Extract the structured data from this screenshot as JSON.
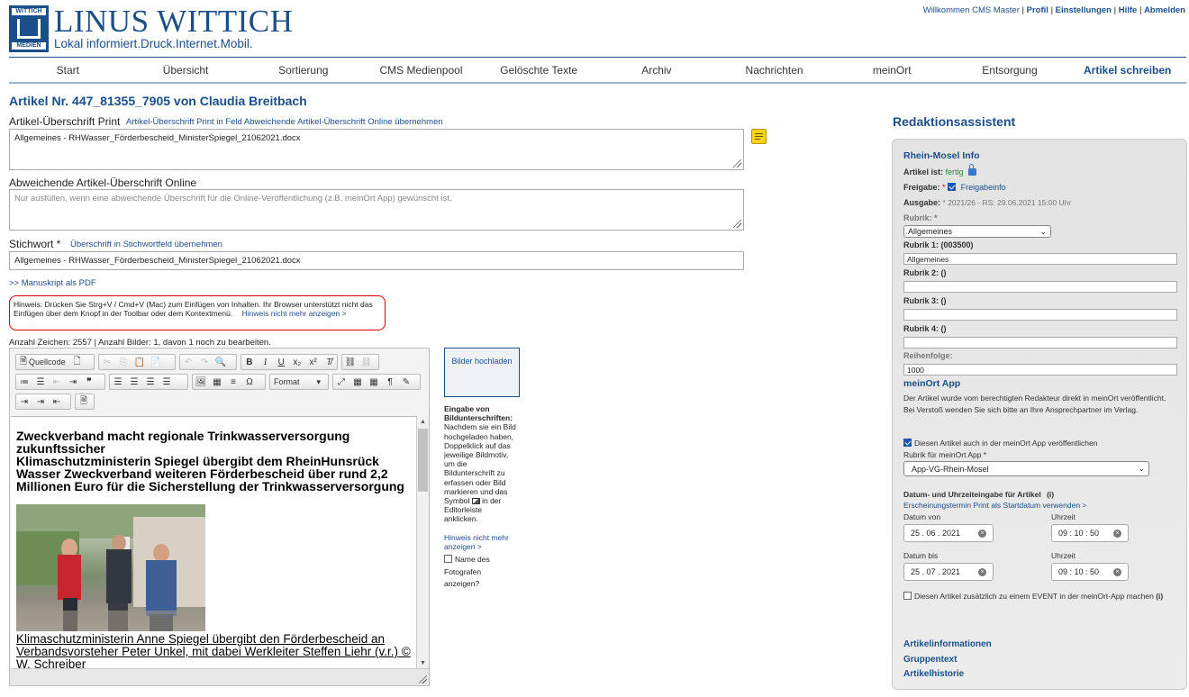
{
  "logo": {
    "box_top": "WITTICH",
    "box_bottom": "MEDIEN",
    "title": "LINUS WITTICH",
    "subtitle": "Lokal informiert.Druck.Internet.Mobil."
  },
  "toplinks": {
    "welcome": "Willkommen CMS Master",
    "profil": "Profil",
    "einstellungen": "Einstellungen",
    "hilfe": "Hilfe",
    "abmelden": "Abmelden",
    "sep": "|"
  },
  "nav": [
    "Start",
    "Übersicht",
    "Sortierung",
    "CMS Medienpool",
    "Gelöschte Texte",
    "Archiv",
    "Nachrichten",
    "meinOrt",
    "Entsorgung",
    "Artikel schreiben"
  ],
  "article": {
    "title": "Artikel Nr. 447_81355_7905 von Claudia Breitbach",
    "headline_print_label": "Artikel-Überschrift Print",
    "headline_print_link": "Artikel-Überschrift Print in Feld Abweichende Artikel-Überschrift Online übernehmen",
    "headline_print_value": "Allgemeines - RHWasser_Förderbescheid_MinisterSpiegel_21062021.docx",
    "headline_online_label": "Abweichende Artikel-Überschrift Online",
    "headline_online_placeholder": "Nur ausfüllen, wenn eine abweichende Überschrift für die Online-Veröffentlichung (z.B. meinOrt App) gewünscht ist.",
    "keyword_label": "Stichwort *",
    "keyword_link": "Überschrift in Stichwortfeld übernehmen",
    "keyword_value": "Allgemeines - RHWasser_Förderbescheid_MinisterSpiegel_21062021.docx",
    "manuscript_link": ">> Manuskript als PDF",
    "hint_text": "Hinweis: Drücken Sie Strg+V / Cmd+V (Mac) zum Einfügen von Inhalten. Ihr Browser unterstützt nicht das Einfügen über dem Knopf in der Toolbar oder dem Kontextmenü.",
    "hint_link": "Hinweis nicht mehr anzeigen >",
    "counts": "Anzahl Zeichen: 2557  |  Anzahl Bilder: 1, davon 1 noch zu bearbeiten."
  },
  "editor": {
    "source_label": "Quellcode",
    "format_label": "Format",
    "heading": "Zweckverband macht regionale Trinkwasserversorgung zukunftssicher\nKlimaschutzministerin Spiegel übergibt dem RheinHunsrück Wasser Zweckverband weiteren Förderbescheid über rund 2,2 Millionen Euro für die Sicherstellung der Trinkwasserversorgung",
    "caption": "Klimaschutzministerin Anne Spiegel übergibt den Förderbescheid an Verbandsvorsteher Peter Unkel, mit dabei Werkleiter Steffen Liehr (v.r.) © W. Schreiber"
  },
  "upload": {
    "button": "Bilder hochladen",
    "help_title": "Eingabe von Bildunterschriften:",
    "help_text_1": "Nachdem sie ein Bild hochgeladen haben, Doppelklick auf das jeweilige Bildmotiv, um die Bildunterschrift zu erfassen oder Bild markieren und das Symbol",
    "help_text_2": "in der Editorleiste anklicken.",
    "help_link": "Hinweis nicht mehr anzeigen >",
    "photographer_label": "Name des Fotografen anzeigen?"
  },
  "assistant": {
    "title": "Redaktionsassistent",
    "section": "Rhein-Mosel Info",
    "status_label": "Artikel ist:",
    "status_value": "fertig",
    "release_label": "Freigabe:",
    "release_req": "*",
    "release_link": "Freigabeinfo",
    "issue_label": "Ausgabe:",
    "issue_value": "* 2021/26 - RS: 29.06.2021 15:00 Uhr",
    "rubrik_label": "Rubrik: *",
    "rubrik_value": "Allgemeines",
    "rubrik1_label": "Rubrik 1: (003500)",
    "rubrik1_value": "Allgemeines",
    "rubrik2_label": "Rubrik 2: ()",
    "rubrik3_label": "Rubrik 3: ()",
    "rubrik4_label": "Rubrik 4: ()",
    "order_label": "Reihenfolge:",
    "order_value": "1000",
    "meinort_title": "meinOrt App",
    "meinort_text_1": "Der Artikel wurde vom berechtigten Redakteur direkt in meinOrt veröffentlicht.",
    "meinort_text_2": "Bei Verstoß wenden Sie sich bitte an Ihre Ansprechpartner im Verlag.",
    "publish_app_label": "Diesen Artikel auch in der meinOrt App veröffentlichen",
    "rubrik_app_label": "Rubrik für meinOrt App *",
    "rubrik_app_value": "App-VG-Rhein-Mosel",
    "datetime_title": "Datum- und Uhrzeiteingabe für Artikel",
    "datetime_info": "(i)",
    "datetime_link": "Erscheinungstermin Print als Startdatum verwenden >",
    "date_from_label": "Datum von",
    "date_from_value": "25 . 06 . 2021",
    "time_from_label": "Uhrzeit",
    "time_from_value": "09 : 10 : 50",
    "date_to_label": "Datum bis",
    "date_to_value": "25 . 07 . 2021",
    "time_to_label": "Uhrzeit",
    "time_to_value": "09 : 10 : 50",
    "event_label": "Diesen Artikel zusätzlich zu einem EVENT in der meinOrt-App machen",
    "event_info": "(i)",
    "link_info": "Artikelinformationen",
    "link_group": "Gruppentext",
    "link_history": "Artikelhistorie"
  },
  "colors": {
    "brand": "#1a4f8a",
    "hint_border": "#dd0000",
    "status_ok": "#2a8a2a"
  }
}
